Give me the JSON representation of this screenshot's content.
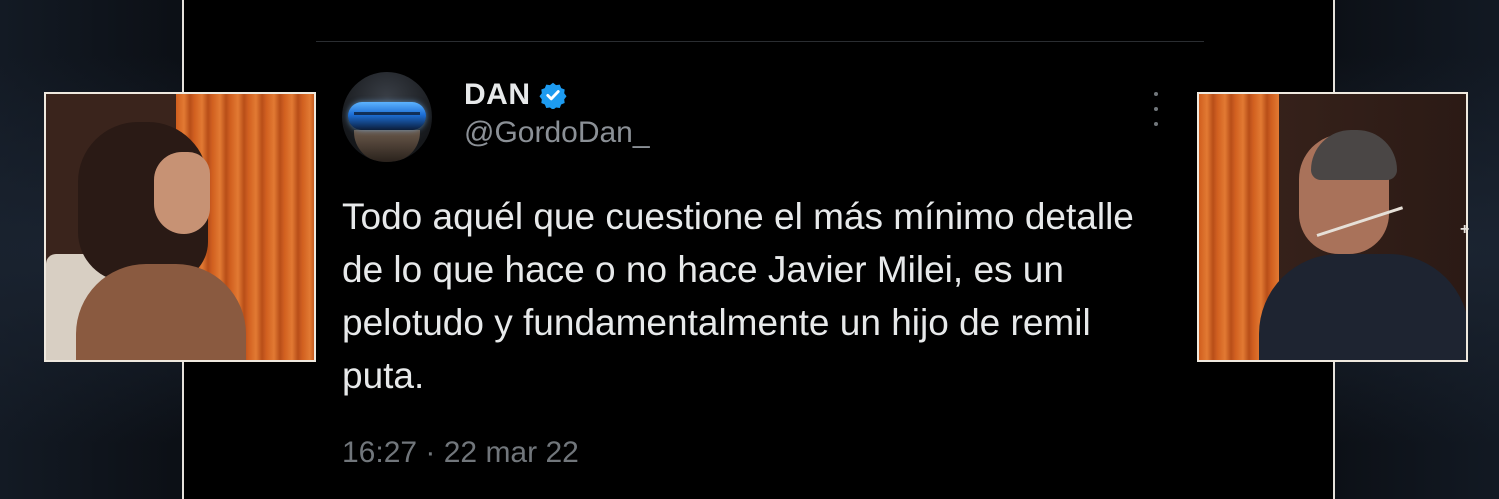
{
  "tweet": {
    "display_name": "DAN",
    "verified": true,
    "verified_color": "#1d9bf0",
    "handle": "@GordoDan_",
    "text": "Todo aquél que cuestione el más mínimo detalle de lo que hace o no hace Javier Milei, es un pelotudo y fundamentalmente un hijo de remil puta.",
    "timestamp": "16:27 · 22 mar 22",
    "more_icon": "more-vertical-icon"
  },
  "overlay": {
    "left_frame": "video-frame-woman",
    "right_frame": "video-frame-man",
    "plus_glyph": "+"
  }
}
